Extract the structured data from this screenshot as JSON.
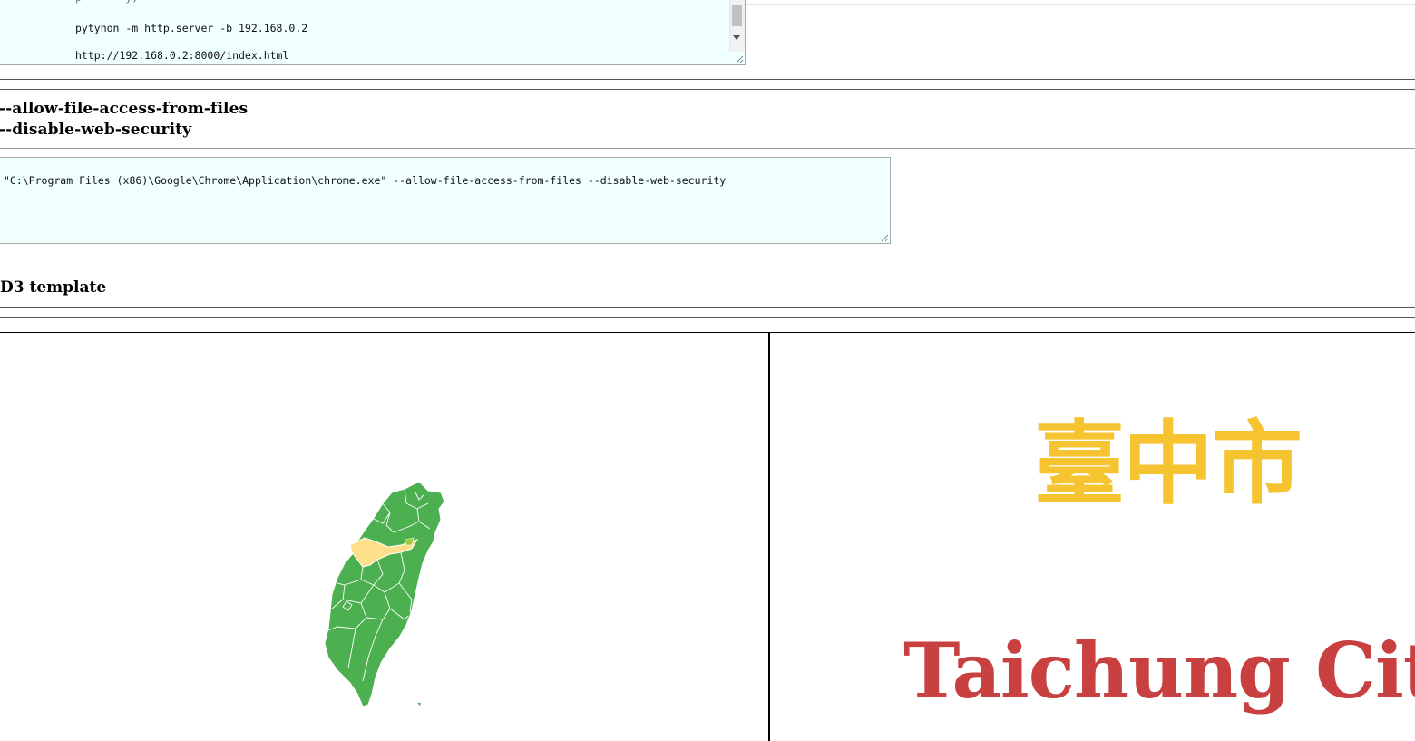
{
  "code_block_1": {
    "lines": [
      "pytyhon -m http.server -b 192.168.0.2",
      "http://192.168.0.2:8000/index.html"
    ]
  },
  "flags": [
    "--allow-file-access-from-files",
    "--disable-web-security"
  ],
  "code_block_2": {
    "command": "\"C:\\Program Files (x86)\\Google\\Chrome\\Application\\chrome.exe\" --allow-file-access-from-files --disable-web-security"
  },
  "section_title": "D3 template",
  "map": {
    "land_color": "#4caf50",
    "highlight_color": "#ffe08a",
    "border_color": "#ffffff"
  },
  "city": {
    "name_zh": "臺中市",
    "name_en": "Taichung City",
    "zh_color": "#f5c430",
    "en_color": "#c94040"
  }
}
